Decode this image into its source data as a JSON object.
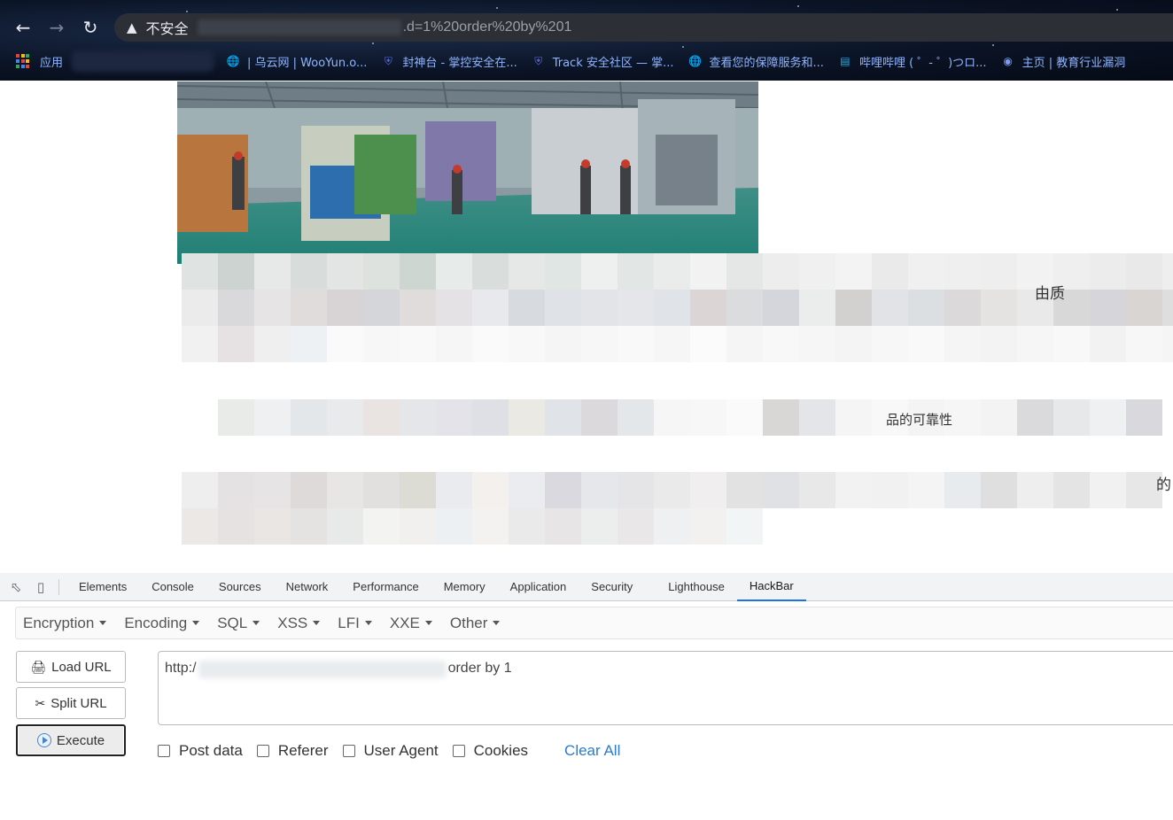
{
  "browser": {
    "security_label": "不安全",
    "url_tail": ".d=1%20order%20by%201",
    "bookmarks": [
      {
        "label": "应用",
        "icon": "apps-grid-icon"
      },
      {
        "label": "| 乌云网 | WooYun.o...",
        "icon": "globe-icon"
      },
      {
        "label": "封神台 - 掌控安全在...",
        "icon": "shield-icon"
      },
      {
        "label": "Track 安全社区 — 掌...",
        "icon": "shield-icon"
      },
      {
        "label": "查看您的保障服务和...",
        "icon": "globe-icon"
      },
      {
        "label": "哔哩哔哩 ( ゜- ゜)つロ...",
        "icon": "bilibili-icon"
      },
      {
        "label": "主页 | 教育行业漏洞",
        "icon": "edu-icon"
      }
    ]
  },
  "page": {
    "text_fragment_1": "由质",
    "text_fragment_2": "品的可靠性",
    "text_fragment_3": "的"
  },
  "devtools": {
    "tabs": [
      "Elements",
      "Console",
      "Sources",
      "Network",
      "Performance",
      "Memory",
      "Application",
      "Security",
      "Lighthouse",
      "HackBar"
    ],
    "active_tab": "HackBar"
  },
  "hackbar": {
    "menu": [
      "Encryption",
      "Encoding",
      "SQL",
      "XSS",
      "LFI",
      "XXE",
      "Other"
    ],
    "buttons": {
      "load": "Load URL",
      "split": "Split URL",
      "execute": "Execute"
    },
    "url_prefix": "http:/",
    "url_suffix": "order by 1",
    "options": [
      "Post data",
      "Referer",
      "User Agent",
      "Cookies"
    ],
    "clear_all": "Clear All"
  }
}
